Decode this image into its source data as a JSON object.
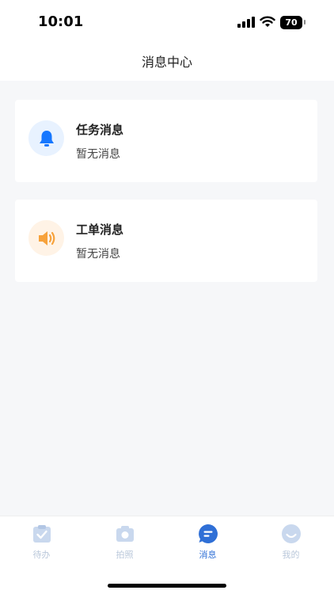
{
  "status_bar": {
    "time": "10:01",
    "battery": "70"
  },
  "header": {
    "title": "消息中心"
  },
  "messages": [
    {
      "title": "任务消息",
      "subtitle": "暂无消息",
      "icon": "bell-icon",
      "icon_color": "#1677ff",
      "icon_bg": "#e8f2ff"
    },
    {
      "title": "工单消息",
      "subtitle": "暂无消息",
      "icon": "speaker-icon",
      "icon_color": "#f7a23b",
      "icon_bg": "#fff3e6"
    }
  ],
  "tabs": [
    {
      "label": "待办",
      "icon": "todo-icon",
      "active": false
    },
    {
      "label": "拍照",
      "icon": "camera-icon",
      "active": false
    },
    {
      "label": "消息",
      "icon": "message-icon",
      "active": true
    },
    {
      "label": "我的",
      "icon": "profile-icon",
      "active": false
    }
  ],
  "colors": {
    "accent": "#2f6fd6",
    "inactive": "#b9c7da",
    "background": "#f6f7f9"
  }
}
